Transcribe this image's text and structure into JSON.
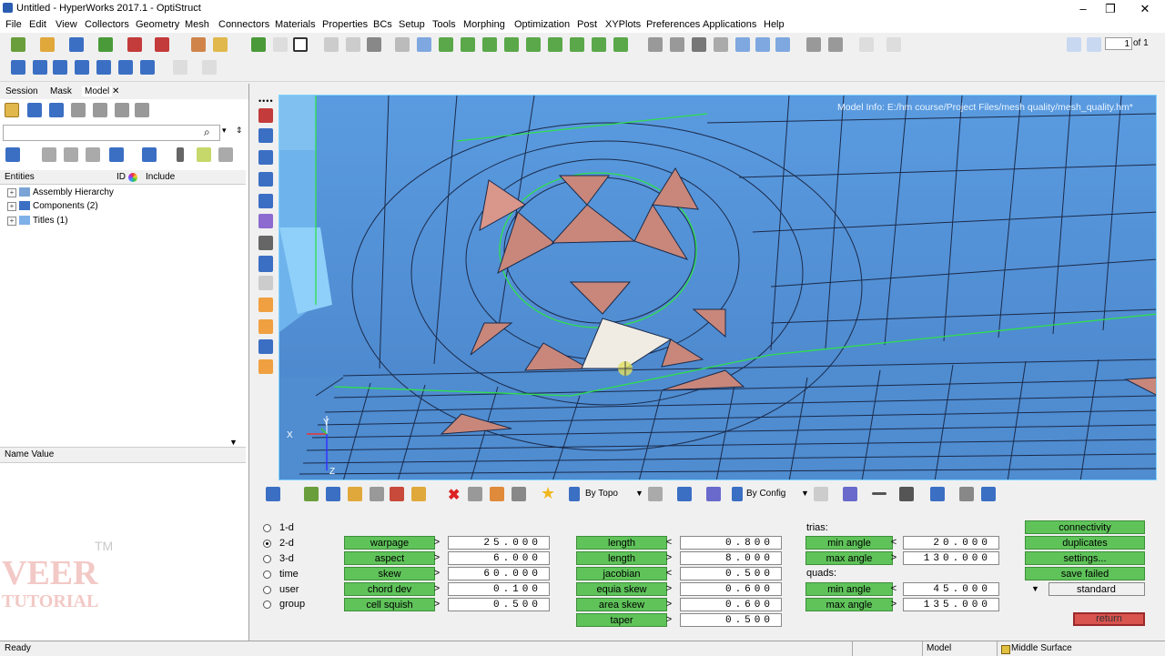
{
  "window": {
    "title": "Untitled - HyperWorks 2017.1 - OptiStruct",
    "minimize": "–",
    "maximize": "❐",
    "close": "✕"
  },
  "menu": [
    "File",
    "Edit",
    "View",
    "Collectors",
    "Geometry",
    "Mesh",
    "Connectors",
    "Materials",
    "Properties",
    "BCs",
    "Setup",
    "Tools",
    "Morphing",
    "Optimization",
    "Post",
    "XYPlots",
    "Preferences",
    "Applications",
    "Help"
  ],
  "pager": {
    "page": "1",
    "of": "of 1"
  },
  "browser": {
    "tabs": [
      "Session",
      "Mask",
      "Model"
    ],
    "tab_close": "✕",
    "columns": {
      "entities": "Entities",
      "id": "ID",
      "include": "Include"
    },
    "tree": [
      "Assembly Hierarchy",
      "Components (2)",
      "Titles (1)"
    ],
    "name_value_header": "Name Value"
  },
  "viewport": {
    "model_info": "Model Info: E:/hm course/Project Files/mesh quality/mesh_quality.hm*",
    "triad": {
      "x": "X",
      "y": "Y",
      "z": "Z"
    }
  },
  "bottom_toolbar": {
    "by_topo": "By Topo",
    "by_config": "By Config"
  },
  "panel": {
    "radios": [
      {
        "label": "1-d",
        "selected": false
      },
      {
        "label": "2-d",
        "selected": true
      },
      {
        "label": "3-d",
        "selected": false
      },
      {
        "label": "time",
        "selected": false
      },
      {
        "label": "user",
        "selected": false
      },
      {
        "label": "group",
        "selected": false
      }
    ],
    "col1": [
      {
        "name": "warpage",
        "op": ">",
        "value": "25.000"
      },
      {
        "name": "aspect",
        "op": ">",
        "value": "6.000"
      },
      {
        "name": "skew",
        "op": ">",
        "value": "60.000"
      },
      {
        "name": "chord dev",
        "op": ">",
        "value": "0.100"
      },
      {
        "name": "cell squish",
        "op": ">",
        "value": "0.500"
      }
    ],
    "col2": [
      {
        "name": "length",
        "op": "<",
        "value": "0.800"
      },
      {
        "name": "length",
        "op": ">",
        "value": "8.000"
      },
      {
        "name": "jacobian",
        "op": "<",
        "value": "0.500"
      },
      {
        "name": "equia skew",
        "op": ">",
        "value": "0.600"
      },
      {
        "name": "area skew",
        "op": ">",
        "value": "0.600"
      },
      {
        "name": "taper",
        "op": ">",
        "value": "0.500"
      }
    ],
    "trias_label": "trias:",
    "trias": [
      {
        "name": "min angle",
        "op": "<",
        "value": "20.000"
      },
      {
        "name": "max angle",
        "op": ">",
        "value": "130.000"
      }
    ],
    "quads_label": "quads:",
    "quads": [
      {
        "name": "min angle",
        "op": "<",
        "value": "45.000"
      },
      {
        "name": "max angle",
        "op": ">",
        "value": "135.000"
      }
    ],
    "actions": [
      "connectivity",
      "duplicates",
      "settings...",
      "save failed"
    ],
    "standard": "standard",
    "return": "return"
  },
  "status": {
    "ready": "Ready",
    "model": "Model",
    "surface": "Middle Surface"
  },
  "watermark": {
    "tm": "TM",
    "line1": "VEER",
    "line2": "TUTORIAL"
  },
  "colors": {
    "mesh_blue": "#5b9bd5",
    "failed": "#c8877a",
    "selected": "#f0ece4",
    "button_green": "#5fc35a",
    "return_red": "#d9534f"
  }
}
